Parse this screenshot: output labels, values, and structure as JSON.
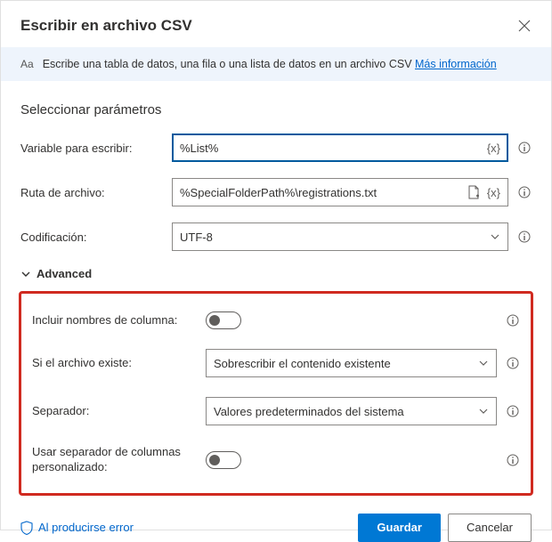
{
  "header": {
    "title": "Escribir en archivo CSV"
  },
  "banner": {
    "icon_label": "Aa",
    "text": "Escribe una tabla de datos, una fila o una lista de datos en un archivo CSV ",
    "link": "Más información"
  },
  "section_title": "Seleccionar parámetros",
  "params": {
    "variable_label": "Variable para escribir:",
    "variable_value": "%List%",
    "path_label": "Ruta de archivo:",
    "path_value": "%SpecialFolderPath%\\registrations.txt",
    "encoding_label": "Codificación:",
    "encoding_value": "UTF-8"
  },
  "advanced": {
    "toggle_label": "Advanced",
    "include_cols_label": "Incluir nombres de columna:",
    "if_exists_label": "Si el archivo existe:",
    "if_exists_value": "Sobrescribir el contenido existente",
    "separator_label": "Separador:",
    "separator_value": "Valores predeterminados del sistema",
    "custom_sep_label": "Usar separador de columnas personalizado:"
  },
  "footer": {
    "on_error": "Al producirse error",
    "save": "Guardar",
    "cancel": "Cancelar"
  }
}
